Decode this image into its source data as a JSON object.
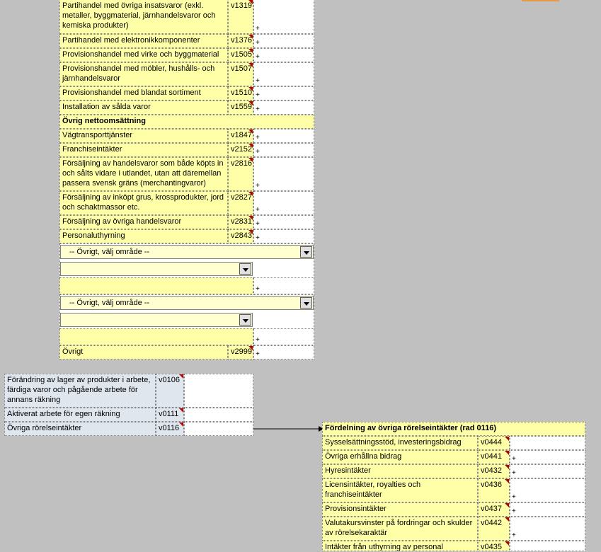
{
  "rows_top": [
    {
      "label": "Partihandel med övriga insatsvaror (exkl. metaller, byggmaterial, järnhandelsvaror och kemiska produkter)",
      "code": "v1319"
    },
    {
      "label": "Partihandel med elektronikkomponenter",
      "code": "v1376"
    },
    {
      "label": "Provisionshandel med virke och byggmaterial",
      "code": "v1505"
    },
    {
      "label": "Provisionshandel med möbler, hushålls- och järnhandelsvaror",
      "code": "v1507"
    },
    {
      "label": "Provisionshandel med blandat sortiment",
      "code": "v1510"
    },
    {
      "label": "Installation av sålda varor",
      "code": "v1559"
    }
  ],
  "section_header": "Övrig nettoomsättning",
  "rows_mid": [
    {
      "label": "Vägtransporttjänster",
      "code": "v1847"
    },
    {
      "label": "Franchiseintäkter",
      "code": "v2152"
    },
    {
      "label": "Försäljning av handelsvaror som både köpts in och sålts vidare i utlandet, utan att däremellan passera svensk gräns (merchantingvaror)",
      "code": "v2816"
    },
    {
      "label": "Försäljning av inköpt grus, krossprodukter, jord och schaktmassor etc.",
      "code": "v2827"
    },
    {
      "label": "Försäljning av övriga handelsvaror",
      "code": "v2831"
    },
    {
      "label": "Personaluthyrning",
      "code": "v2843"
    }
  ],
  "dropdown_area_label": "-- Övrigt,  välj område --",
  "plus_sign": "+",
  "ovrigt": {
    "label": "Övrigt",
    "code": "v2999"
  },
  "left_rows": [
    {
      "label": "Förändring av lager av produkter i arbete, färdiga varor och pågående arbete för annans räkning",
      "code": "v0106"
    },
    {
      "label": "Aktiverat arbete för egen räkning",
      "code": "v0111"
    },
    {
      "label": "Övriga rörelseintäkter",
      "code": "v0116"
    }
  ],
  "fordelning_header": "Fördelning av övriga rörelseintäkter (rad 0116)",
  "right_rows": [
    {
      "label": "Sysselsättningsstöd, investeringsbidrag",
      "code": "v0444"
    },
    {
      "label": "Övriga erhållna bidrag",
      "code": "v0441"
    },
    {
      "label": "Hyresintäkter",
      "code": "v0432"
    },
    {
      "label": "Licensintäkter, royalties och franchiseintäkter",
      "code": "v0436"
    },
    {
      "label": "Provisionsintäkter",
      "code": "v0437"
    },
    {
      "label": "Valutakursvinster på fordringar och skulder av rörelsekaraktär",
      "code": "v0442"
    },
    {
      "label": "Intäkter från uthyrning av personal",
      "code": "v0435"
    }
  ],
  "colors": {
    "background": "#c0c0c0",
    "input_yellow": "#ffffa8",
    "comment_marker": "#c00000",
    "blue_cell": "#dfe6ee"
  }
}
